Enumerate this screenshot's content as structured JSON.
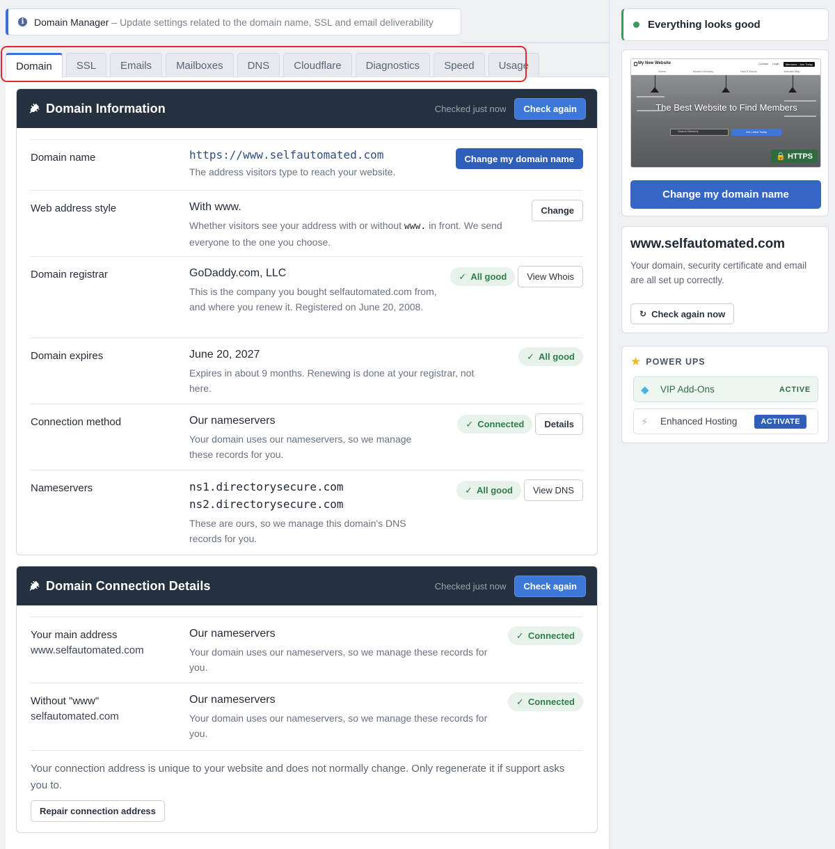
{
  "header": {
    "title": "Domain Manager",
    "description": "– Update settings related to the domain name, SSL and email deliverability"
  },
  "tabs": [
    {
      "label": "Domain",
      "active": true
    },
    {
      "label": "SSL"
    },
    {
      "label": "Emails"
    },
    {
      "label": "Mailboxes"
    },
    {
      "label": "DNS"
    },
    {
      "label": "Cloudflare"
    },
    {
      "label": "Diagnostics"
    },
    {
      "label": "Speed"
    },
    {
      "label": "Usage"
    }
  ],
  "domain_info": {
    "title": "Domain Information",
    "checked": "Checked just now",
    "check_again": "Check again",
    "rows": {
      "domain_name": {
        "label": "Domain name",
        "value": "https://www.selfautomated.com",
        "desc": "The address visitors type to reach your website.",
        "button": "Change my domain name"
      },
      "web_style": {
        "label": "Web address style",
        "value": "With www.",
        "desc_a": "Whether visitors see your address with or without",
        "desc_code": "www.",
        "desc_b": "in front. We send everyone to the one you choose.",
        "button": "Change"
      },
      "registrar": {
        "label": "Domain registrar",
        "value": "GoDaddy.com, LLC",
        "desc": "This is the company you bought selfautomated.com from, and where you renew it. Registered on June 20, 2008.",
        "badge": "All good",
        "button": "View Whois"
      },
      "expires": {
        "label": "Domain expires",
        "value": "June 20, 2027",
        "desc": "Expires in about 9 months. Renewing is done at your registrar, not here.",
        "badge": "All good"
      },
      "connection": {
        "label": "Connection method",
        "value": "Our nameservers",
        "desc": "Your domain uses our nameservers, so we manage these records for you.",
        "badge": "Connected",
        "button": "Details"
      },
      "nameservers": {
        "label": "Nameservers",
        "ns1": "ns1.directorysecure.com",
        "ns2": "ns2.directorysecure.com",
        "desc": "These are ours, so we manage this domain's DNS records for you.",
        "badge": "All good",
        "button": "View DNS"
      }
    }
  },
  "connection_details": {
    "title": "Domain Connection Details",
    "checked": "Checked just now",
    "check_again": "Check again",
    "rows": {
      "main": {
        "label": "Your main address",
        "sub": "www.selfautomated.com",
        "value": "Our nameservers",
        "desc": "Your domain uses our nameservers, so we manage these records for you.",
        "badge": "Connected"
      },
      "without": {
        "label": "Without \"www\"",
        "sub": "selfautomated.com",
        "value": "Our nameservers",
        "desc": "Your domain uses our nameservers, so we manage these records for you.",
        "badge": "Connected"
      }
    },
    "note": "Your connection address is unique to your website and does not normally change. Only regenerate it if support asks you to.",
    "repair_button": "Repair connection address"
  },
  "sidebar": {
    "status": "Everything looks good",
    "preview": {
      "site_name": "My New Website",
      "nav_links": [
        "Home",
        "Search Directory",
        "How It Works",
        "Website Map"
      ],
      "top_links": [
        "Contact",
        "Login",
        "Members - Join Today"
      ],
      "hero_title": "The Best Website to Find Members",
      "search_placeholder": "Search Directory",
      "search_button": "Get Listed Today",
      "https_badge": "HTTPS"
    },
    "change_button": "Change my domain name",
    "domain_card": {
      "title": "www.selfautomated.com",
      "desc": "Your domain, security certificate and email are all set up correctly.",
      "button": "Check again now"
    },
    "power_ups": {
      "title": "POWER UPS",
      "items": [
        {
          "label": "VIP Add-Ons",
          "status": "ACTIVE"
        },
        {
          "label": "Enhanced Hosting",
          "action": "ACTIVATE"
        }
      ]
    }
  },
  "colors": {
    "accent": "#3d6fd6",
    "dark_header": "#263140",
    "success": "#2f7d49",
    "highlight": "#e3262a"
  }
}
